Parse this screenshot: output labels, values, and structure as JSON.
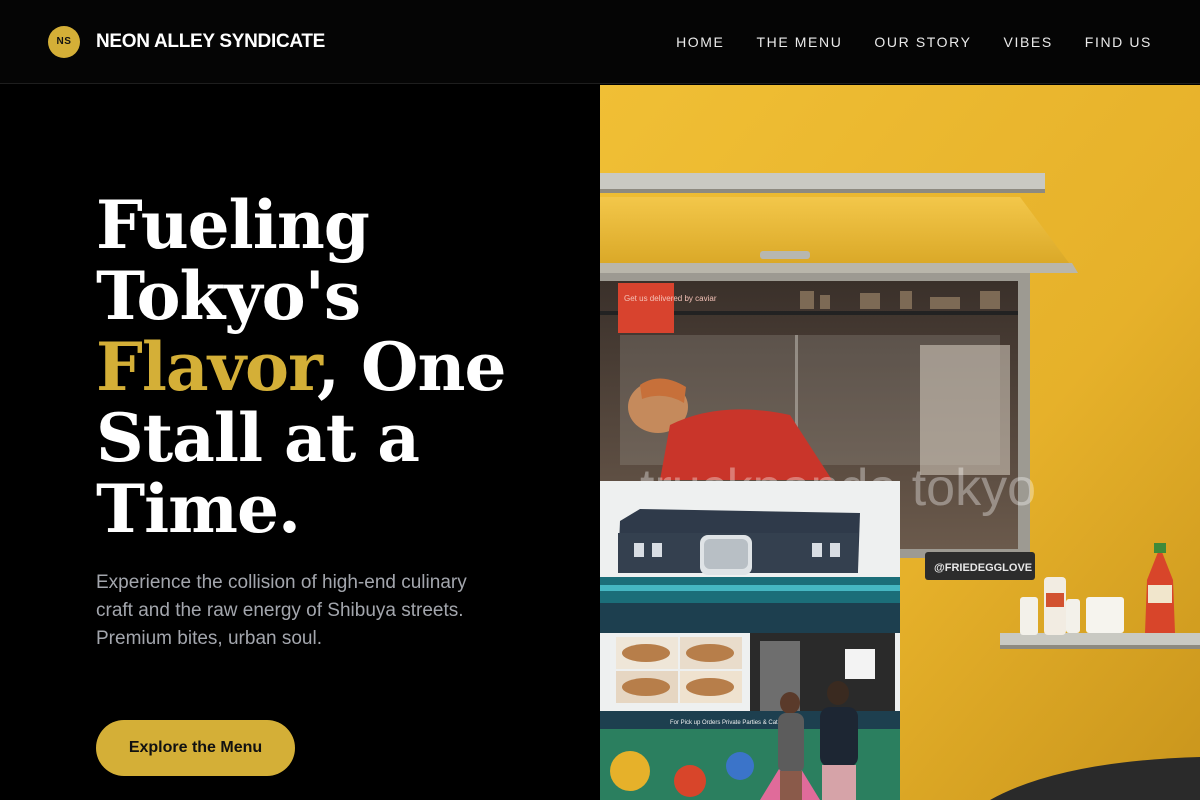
{
  "brand": {
    "logo_text": "NS",
    "name": "NEON ALLEY SYNDICATE"
  },
  "nav": [
    {
      "label": "HOME"
    },
    {
      "label": "THE MENU"
    },
    {
      "label": "OUR STORY"
    },
    {
      "label": "VIBES"
    },
    {
      "label": "FIND US"
    }
  ],
  "hero": {
    "headline_part1": "Fueling Tokyo's ",
    "headline_accent": "Flavor",
    "headline_part2": ", One Stall at a Time.",
    "subtext": "Experience the collision of high-end culinary craft and the raw energy of Shibuya streets. Premium bites, urban soul.",
    "cta_label": "Explore the Menu"
  },
  "images": {
    "truck_sign": "@FRIEDEGGLOVE",
    "watermark": "truckpanda tokyo",
    "window_sticker": "Get us delivered by caviar",
    "inset_banner": "For Pick up Orders Private Parties & Catering Pier"
  },
  "colors": {
    "accent": "#d4af37",
    "background": "#000000",
    "truck_yellow": "#e8b52c"
  }
}
